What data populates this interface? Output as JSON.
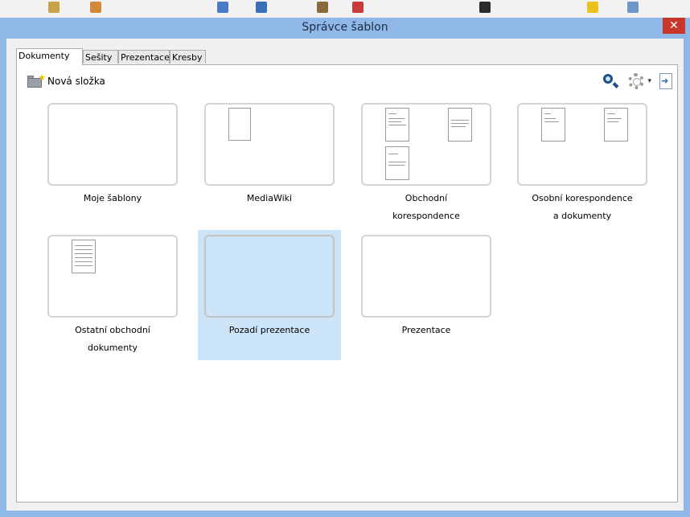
{
  "window": {
    "title": "Správce šablon",
    "close_glyph": "✕"
  },
  "tabs": [
    {
      "label": "Dokumenty",
      "active": true
    },
    {
      "label": "Sešity",
      "active": false
    },
    {
      "label": "Prezentace",
      "active": false
    },
    {
      "label": "Kresby",
      "active": false
    }
  ],
  "toolbar": {
    "new_folder_label": "Nová složka",
    "new_folder_icon": "folder-new-icon",
    "search_icon": "search-icon",
    "settings_icon": "gear-icon",
    "settings_menu_glyph": "▾",
    "import_icon": "import-icon"
  },
  "folders": [
    {
      "line1": "Moje šablony",
      "line2": "",
      "selected": false
    },
    {
      "line1": "MediaWiki",
      "line2": "",
      "selected": false
    },
    {
      "line1": "Obchodní",
      "line2": "korespondence",
      "selected": false
    },
    {
      "line1": "Osobní korespondence",
      "line2": "a dokumenty",
      "selected": false
    },
    {
      "line1": "Ostatní obchodní",
      "line2": "dokumenty",
      "selected": false
    },
    {
      "line1": "Pozadí prezentace",
      "line2": "",
      "selected": true
    },
    {
      "line1": "Prezentace",
      "line2": "",
      "selected": false
    }
  ],
  "colors": {
    "selection": "#cce4f7",
    "titlebar": "#8fb7e8",
    "close": "#c7382c"
  }
}
